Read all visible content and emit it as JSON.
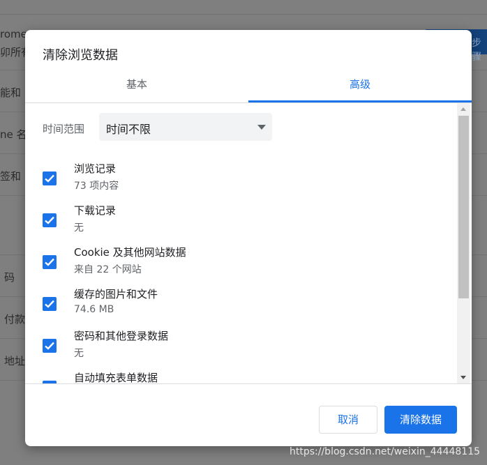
{
  "background": {
    "text_1": "rome",
    "text_2": "卯所有",
    "text_3": "能和",
    "text_4": "ne 名",
    "text_5": "签和",
    "text_6": "码",
    "text_7": "付款",
    "text_8": "地址",
    "text_9": "步骤"
  },
  "dialog": {
    "title": "清除浏览数据",
    "tabs": [
      {
        "label": "基本"
      },
      {
        "label": "高级"
      }
    ],
    "time_range": {
      "label": "时间范围",
      "value": "时间不限"
    },
    "items": [
      {
        "title": "浏览记录",
        "subtitle": "73 项内容",
        "checked": true
      },
      {
        "title": "下载记录",
        "subtitle": "无",
        "checked": true
      },
      {
        "title": "Cookie 及其他网站数据",
        "subtitle": "来自 22 个网站",
        "checked": true
      },
      {
        "title": "缓存的图片和文件",
        "subtitle": "74.6 MB",
        "checked": true
      },
      {
        "title": "密码和其他登录数据",
        "subtitle": "无",
        "checked": true
      },
      {
        "title": "自动填充表单数据",
        "subtitle": "",
        "checked": true
      }
    ],
    "buttons": {
      "cancel": "取消",
      "clear": "清除数据"
    }
  },
  "watermark": "https://blog.csdn.net/weixin_44448115",
  "colors": {
    "accent": "#1a73e8",
    "overlay": "#7b7b7b"
  }
}
